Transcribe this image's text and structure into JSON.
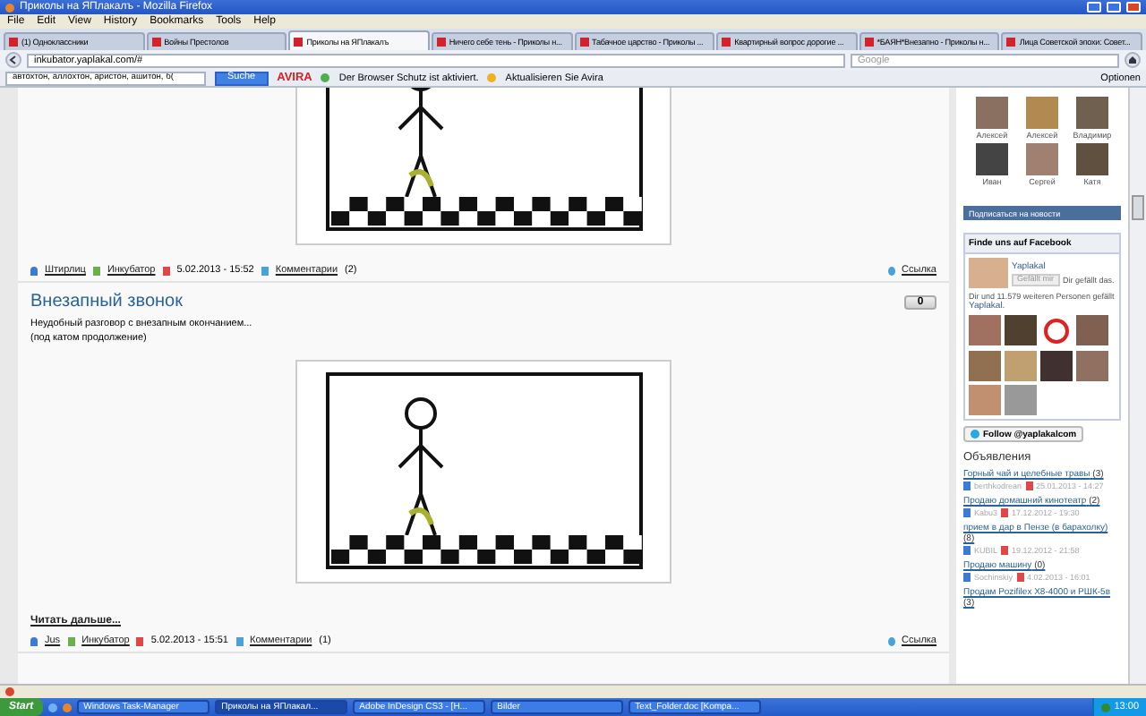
{
  "window": {
    "title": "Приколы на ЯПлакалъ - Mozilla Firefox"
  },
  "menu": [
    "File",
    "Edit",
    "View",
    "History",
    "Bookmarks",
    "Tools",
    "Help"
  ],
  "tabs": [
    {
      "label": "(1) Одноклассники",
      "selected": false
    },
    {
      "label": "Войны Престолов",
      "selected": false
    },
    {
      "label": "Приколы на ЯПлакалъ",
      "selected": true
    },
    {
      "label": "Ничего себе тень - Приколы н...",
      "selected": false
    },
    {
      "label": "Табачное царство - Приколы ...",
      "selected": false
    },
    {
      "label": "Квартирный вопрос дорогие ...",
      "selected": false
    },
    {
      "label": "*БАЯН*Внезапно - Приколы н...",
      "selected": false
    },
    {
      "label": "Лица Советской эпохи: Совет...",
      "selected": false
    }
  ],
  "address": {
    "value": "inkubator.yaplakal.com/#"
  },
  "search": {
    "placeholder": "Google"
  },
  "avira": {
    "search_value": "автохтон, аллохтон, аристон, ашитон, б(",
    "search_button": "Suche",
    "brand": "AVIRA",
    "status": "Der Browser Schutz ist aktiviert.",
    "update": "Aktualisieren Sie Avira",
    "options": "Optionen"
  },
  "posts": [
    {
      "meta": {
        "author": "Штирлиц",
        "category": "Инкубатор",
        "date": "5.02.2013 - 15:52",
        "comments": "Комментарии",
        "comments_count": "(2)",
        "link": "Ссылка"
      }
    },
    {
      "title": "Внезапный звонок",
      "score": "0",
      "lines": [
        "Неудобный разговор с внезапным окончанием...",
        "(под катом продолжение)"
      ],
      "read_more": "Читать дальше...",
      "meta": {
        "author": "Jus",
        "category": "Инкубатор",
        "date": "5.02.2013 - 15:51",
        "comments": "Комментарии",
        "comments_count": "(1)",
        "link": "Ссылка"
      }
    }
  ],
  "friends": [
    "Алексей",
    "Алексей",
    "Владимир",
    "Иван",
    "Сергей",
    "Катя"
  ],
  "subscribe": "Подписаться на новости",
  "facebook": {
    "heading": "Finde uns auf Facebook",
    "page": "Yaplakal",
    "like": "Gefällt mir",
    "liked": "Dir gefällt das.",
    "summary": "Dir und 11.579 weiteren Personen gefällt",
    "summary_link": "Yaplakal."
  },
  "follow": "Follow @yaplakalcom",
  "ads": {
    "heading": "Объявления",
    "items": [
      {
        "title": "Горный чай и целебные травы",
        "count": "(3)",
        "user": "berthkodrean",
        "date": "25.01.2013 - 14:27"
      },
      {
        "title": "Продаю домашний кинотеатр",
        "count": "(2)",
        "user": "Kabu3",
        "date": "17.12.2012 - 19:30"
      },
      {
        "title": "прием в дар в Пензе (в барахолку)",
        "count": "(8)",
        "user": "KUBIL",
        "date": "19.12.2012 - 21:58"
      },
      {
        "title": "Продаю машину",
        "count": "(0)",
        "user": "Sochinskiy",
        "date": "4.02.2013 - 16:01"
      },
      {
        "title": "Продам Pozifilex X8-4000 и PШК-5в",
        "count": "(3)"
      }
    ]
  },
  "taskbar": {
    "start": "Start",
    "items": [
      {
        "label": "Windows Task-Manager",
        "selected": false
      },
      {
        "label": "Приколы на ЯПлакал...",
        "selected": true
      },
      {
        "label": "Adobe InDesign CS3 - [H...",
        "selected": false
      },
      {
        "label": "Bilder",
        "selected": false
      },
      {
        "label": "Text_Folder.doc [Kompa...",
        "selected": false
      }
    ],
    "clock": "13:00"
  }
}
